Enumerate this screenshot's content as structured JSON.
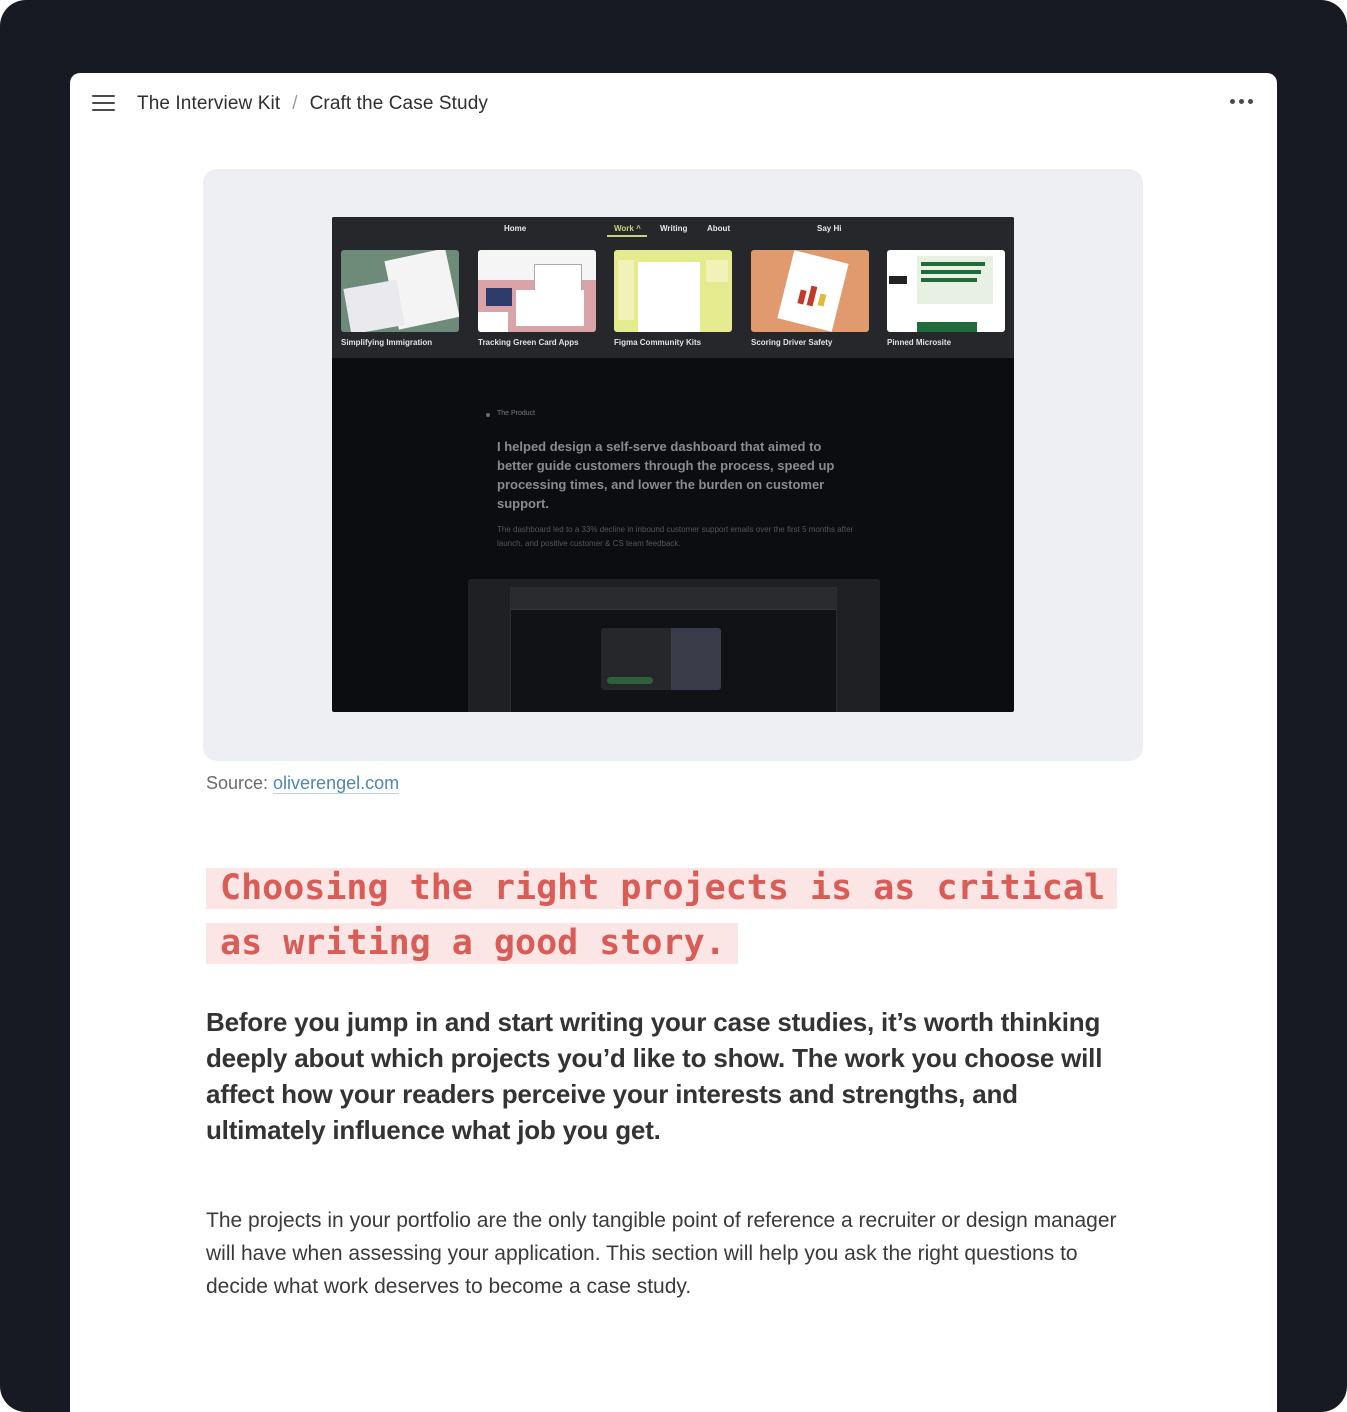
{
  "breadcrumb": {
    "root": "The Interview Kit",
    "separator": "/",
    "current": "Craft the Case Study"
  },
  "icons": {
    "menu": "hamburger-menu-icon",
    "more": "more-horizontal-icon"
  },
  "screenshot": {
    "nav": {
      "home": "Home",
      "work": "Work ^",
      "writing": "Writing",
      "about": "About",
      "say_hi": "Say Hi"
    },
    "cards": [
      {
        "title": "Simplifying Immigration",
        "color": "#6e8a78"
      },
      {
        "title": "Tracking Green Card Apps",
        "color": "#d9a3a7"
      },
      {
        "title": "Figma Community Kits",
        "color": "#e4ea8e"
      },
      {
        "title": "Scoring Driver Safety",
        "color": "#e09a6d"
      },
      {
        "title": "Pinned Microsite",
        "color": "#ffffff"
      }
    ],
    "product_label": "The Product",
    "product_headline": "I helped design a self-serve dashboard that aimed to better guide customers through the process, speed up processing times, and lower the burden on customer support.",
    "product_sub": "The dashboard led to a 33% decline in inbound customer support emails over the first 5 months after launch, and positive customer & CS team feedback."
  },
  "caption": {
    "prefix": "Source: ",
    "link_text": "oliverengel.com"
  },
  "callout": "Choosing the right projects is as critical as writing a good story.",
  "lead": "Before you jump in and start writing your case studies, it’s worth thinking deeply about which projects you’d like to show. The work you choose will affect how your readers perceive your interests and strengths, and ultimately influence what job you get.",
  "body": "The projects in your portfolio are the only tangible point of reference a recruiter or design manager will have when assessing your application. This section will help you ask the right questions to decide what work deserves to become a case study.",
  "colors": {
    "frame": "#171923",
    "callout_text": "#d95c57",
    "callout_bg": "#fbe6e5",
    "link": "#4f86b5"
  }
}
